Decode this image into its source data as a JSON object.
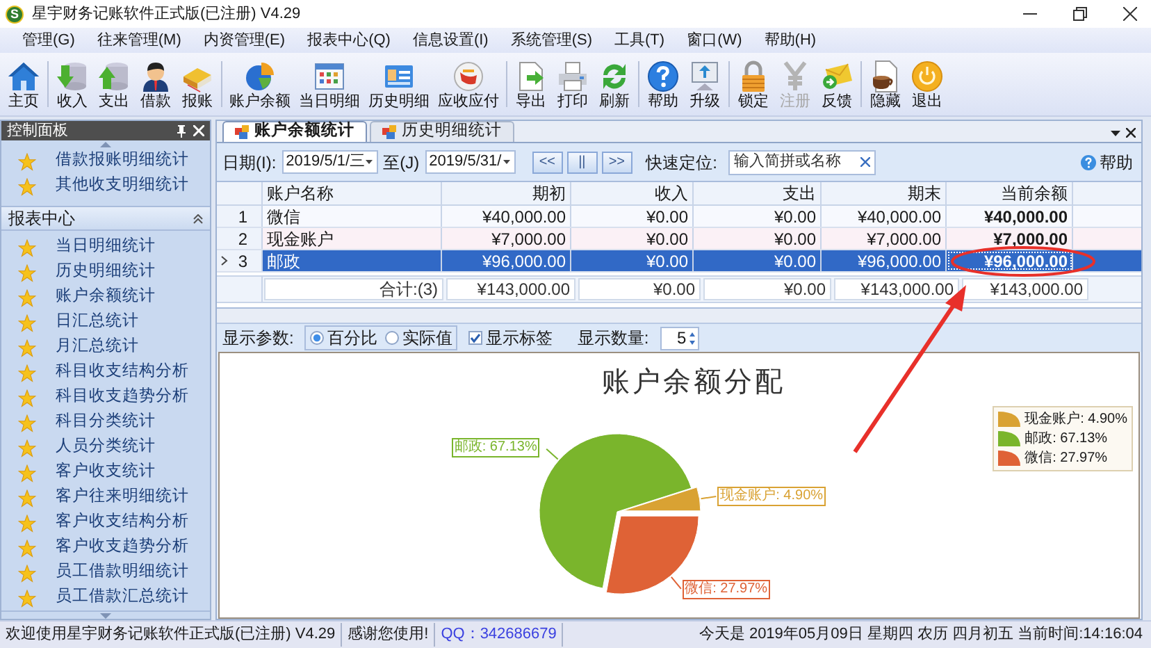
{
  "window": {
    "icon_letter": "S",
    "title": "星宇财务记账软件正式版(已注册) V4.29"
  },
  "menu": [
    "管理(G)",
    "往来管理(M)",
    "内资管理(E)",
    "报表中心(Q)",
    "信息设置(I)",
    "系统管理(S)",
    "工具(T)",
    "窗口(W)",
    "帮助(H)"
  ],
  "toolbar_groups": [
    {
      "buttons": [
        {
          "label": "主页",
          "kind": "home",
          "disabled": false
        }
      ]
    },
    {
      "buttons": [
        {
          "label": "收入",
          "kind": "income",
          "disabled": false
        },
        {
          "label": "支出",
          "kind": "expense",
          "disabled": false
        },
        {
          "label": "借款",
          "kind": "loan",
          "disabled": false
        },
        {
          "label": "报账",
          "kind": "claim",
          "disabled": false
        }
      ]
    },
    {
      "buttons": [
        {
          "label": "账户余额",
          "kind": "balance",
          "disabled": false
        },
        {
          "label": "当日明细",
          "kind": "daily",
          "disabled": false
        },
        {
          "label": "历史明细",
          "kind": "history",
          "disabled": false
        },
        {
          "label": "应收应付",
          "kind": "receivable",
          "disabled": false
        }
      ]
    },
    {
      "buttons": [
        {
          "label": "导出",
          "kind": "export",
          "disabled": false
        },
        {
          "label": "打印",
          "kind": "print",
          "disabled": false
        },
        {
          "label": "刷新",
          "kind": "refresh",
          "disabled": false
        }
      ]
    },
    {
      "buttons": [
        {
          "label": "帮助",
          "kind": "help",
          "disabled": false
        },
        {
          "label": "升级",
          "kind": "upgrade",
          "disabled": false
        }
      ]
    },
    {
      "buttons": [
        {
          "label": "锁定",
          "kind": "lock",
          "disabled": false
        },
        {
          "label": "注册",
          "kind": "register",
          "disabled": true
        },
        {
          "label": "反馈",
          "kind": "feedback",
          "disabled": false
        }
      ]
    },
    {
      "buttons": [
        {
          "label": "隐藏",
          "kind": "hide",
          "disabled": false
        },
        {
          "label": "退出",
          "kind": "exit",
          "disabled": false
        }
      ]
    }
  ],
  "control_panel": {
    "title": "控制面板",
    "top_items": [
      "借款报账明细统计",
      "其他收支明细统计"
    ],
    "report_center": {
      "title": "报表中心",
      "items": [
        "当日明细统计",
        "历史明细统计",
        "账户余额统计",
        "日汇总统计",
        "月汇总统计",
        "科目收支结构分析",
        "科目收支趋势分析",
        "科目分类统计",
        "人员分类统计",
        "客户收支统计",
        "客户往来明细统计",
        "客户收支结构分析",
        "客户收支趋势分析",
        "员工借款明细统计",
        "员工借款汇总统计"
      ]
    }
  },
  "tabs": [
    {
      "label": "账户余额统计",
      "selected": true
    },
    {
      "label": "历史明细统计",
      "selected": false
    }
  ],
  "filter": {
    "date_label": "日期(I):",
    "date_from": "2019/5/1/三",
    "to_label": "至(J)",
    "date_to": "2019/5/31/",
    "nav_buttons": [
      "<<",
      "||",
      ">>"
    ],
    "locate_label": "快速定位:",
    "locate_placeholder": "输入简拼或名称",
    "help": "帮助"
  },
  "table": {
    "columns": [
      "账户名称",
      "期初",
      "收入",
      "支出",
      "期末",
      "当前余额"
    ],
    "rows": [
      {
        "index": "1",
        "cells": [
          "微信",
          "¥40,000.00",
          "¥0.00",
          "¥0.00",
          "¥40,000.00",
          "¥40,000.00"
        ],
        "selected": false
      },
      {
        "index": "2",
        "cells": [
          "现金账户",
          "¥7,000.00",
          "¥0.00",
          "¥0.00",
          "¥7,000.00",
          "¥7,000.00"
        ],
        "selected": false
      },
      {
        "index": "3",
        "cells": [
          "邮政",
          "¥96,000.00",
          "¥0.00",
          "¥0.00",
          "¥96,000.00",
          "¥96,000.00"
        ],
        "selected": true
      }
    ],
    "totals": [
      "合计:(3)",
      "¥143,000.00",
      "¥0.00",
      "¥0.00",
      "¥143,000.00",
      "¥143,000.00"
    ]
  },
  "chart_options": {
    "label": "显示参数:",
    "radios": [
      {
        "label": "百分比",
        "selected": true
      },
      {
        "label": "实际值",
        "selected": false
      }
    ],
    "show_labels": {
      "label": "显示标签",
      "checked": true
    },
    "count_label": "显示数量:",
    "count": "5"
  },
  "chart": {
    "label_separator": ": ",
    "legend": [
      {
        "text": "现金账户: 4.90%",
        "color": "#d9a233"
      },
      {
        "text": "邮政: 67.13%",
        "color": "#7ab52c"
      },
      {
        "text": "微信: 27.97%",
        "color": "#df6236"
      }
    ],
    "chart_data": {
      "type": "pie",
      "title": "账户余额分配",
      "categories": [
        "现金账户",
        "邮政",
        "微信"
      ],
      "values": [
        4.9,
        67.13,
        27.97
      ],
      "value_labels": [
        "4.90%",
        "67.13%",
        "27.97%"
      ]
    }
  },
  "status_bar": {
    "welcome": "欢迎使用星宇财务记账软件正式版(已注册) V4.29",
    "thanks": "感谢您使用!",
    "qq": "QQ：342686679",
    "today": "今天是 2019年05月09日 星期四 农历 四月初五 当前时间:14:16:04"
  }
}
